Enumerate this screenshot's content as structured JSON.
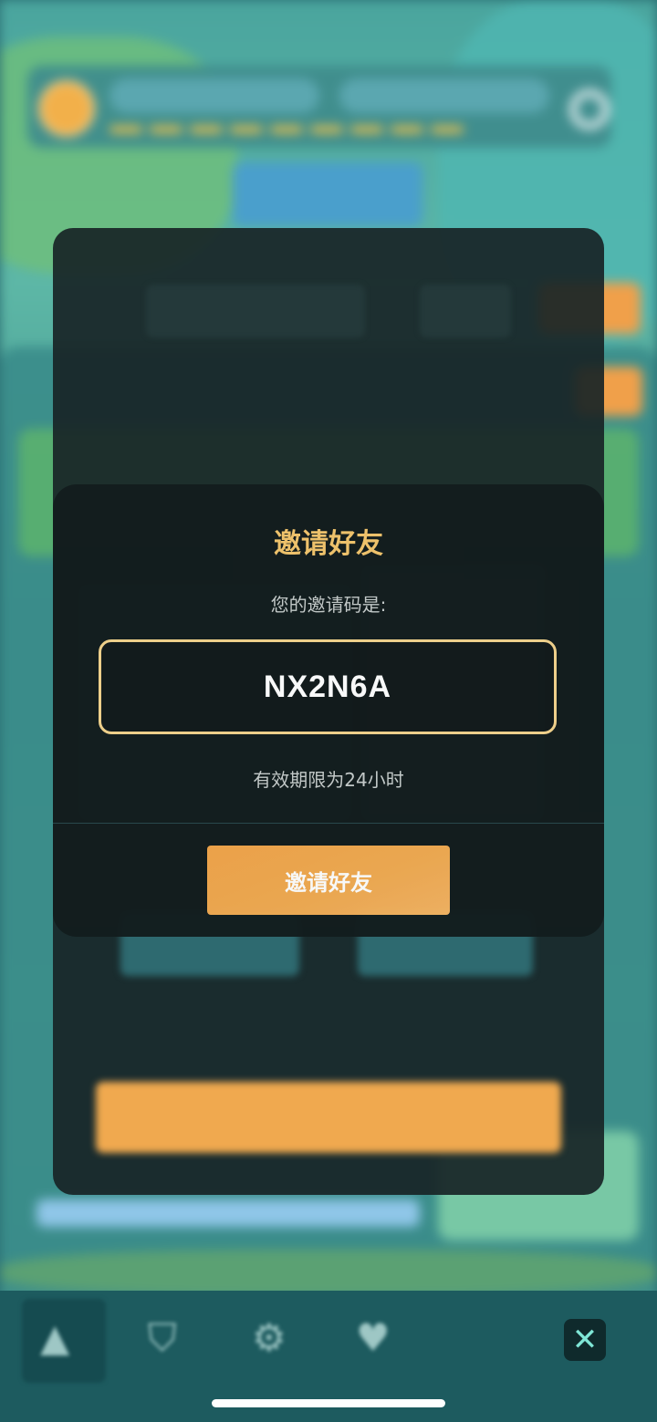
{
  "modal": {
    "title": "邀请好友",
    "subtitle": "您的邀请码是:",
    "invite_code": "NX2N6A",
    "validity": "有效期限为24小时",
    "invite_button": "邀请好友"
  },
  "nav": {
    "close_icon": "close-icon",
    "icons": [
      "triangle-home-icon",
      "shield-icon",
      "gear-icon",
      "heart-icon"
    ]
  },
  "colors": {
    "accent_gold": "#f4c66e",
    "button_orange": "#f2a54a",
    "modal_bg": "#131d1e",
    "close_x": "#7fe6d6"
  }
}
